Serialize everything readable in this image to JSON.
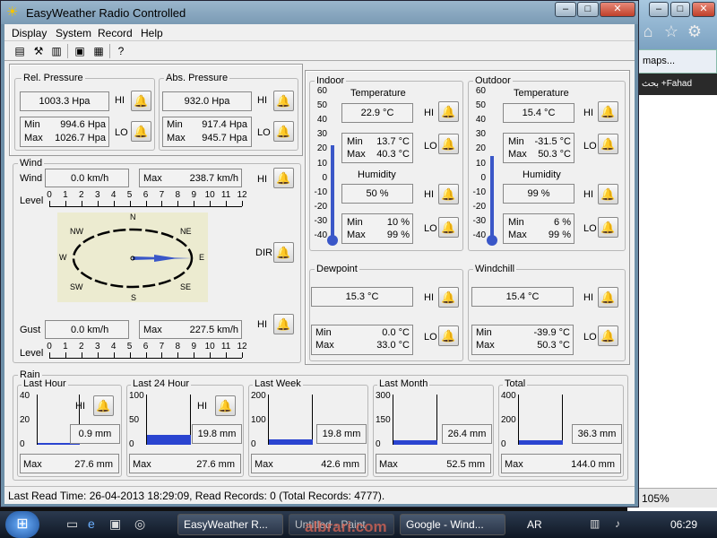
{
  "browser": {
    "tab_label": "maps...",
    "bar_text": "Fahad+ بحث",
    "zoom": "105%"
  },
  "window": {
    "title": "EasyWeather Radio Controlled",
    "min": "–",
    "max": "□",
    "close": "✕"
  },
  "menu": [
    "Display",
    "System",
    "Record",
    "Help"
  ],
  "pressure": {
    "rel_label": "Rel. Pressure",
    "rel_value": "1003.3 Hpa",
    "rel_min": "994.6 Hpa",
    "rel_max": "1026.7 Hpa",
    "abs_label": "Abs. Pressure",
    "abs_value": "932.0 Hpa",
    "abs_min": "917.4 Hpa",
    "abs_max": "945.7 Hpa",
    "min_label": "Min",
    "max_label": "Max"
  },
  "labels": {
    "hi": "HI",
    "lo": "LO",
    "dir": "DIR",
    "min": "Min",
    "max": "Max"
  },
  "wind": {
    "group": "Wind",
    "wind_label": "Wind",
    "wind_value": "0.0 km/h",
    "max_label": "Max",
    "wind_max": "238.7 km/h",
    "level_label": "Level",
    "gust_label": "Gust",
    "gust_value": "0.0 km/h",
    "gust_max": "227.5 km/h",
    "scale": [
      "0",
      "1",
      "2",
      "3",
      "4",
      "5",
      "6",
      "7",
      "8",
      "9",
      "10",
      "11",
      "12"
    ],
    "compass": {
      "N": "N",
      "NE": "NE",
      "E": "E",
      "SE": "SE",
      "S": "S",
      "SW": "SW",
      "W": "W",
      "NW": "NW"
    }
  },
  "indoor": {
    "group": "Indoor",
    "temp_label": "Temperature",
    "temp_value": "22.9 °C",
    "temp_min": "13.7 °C",
    "temp_max": "40.3 °C",
    "hum_label": "Humidity",
    "hum_value": "50 %",
    "hum_min": "10 %",
    "hum_max": "99 %",
    "thermo_temp": 22.9
  },
  "outdoor": {
    "group": "Outdoor",
    "temp_label": "Temperature",
    "temp_value": "15.4 °C",
    "temp_min": "-31.5 °C",
    "temp_max": "50.3 °C",
    "hum_label": "Humidity",
    "hum_value": "99 %",
    "hum_min": "6 %",
    "hum_max": "99 %",
    "thermo_temp": 15.4
  },
  "temp_scale": [
    "60",
    "50",
    "40",
    "30",
    "20",
    "10",
    "0",
    "-10",
    "-20",
    "-30",
    "-40"
  ],
  "dewpoint": {
    "group": "Dewpoint",
    "value": "15.3 °C",
    "min": "0.0 °C",
    "max": "33.0 °C"
  },
  "windchill": {
    "group": "Windchill",
    "value": "15.4 °C",
    "min": "-39.9 °C",
    "max": "50.3 °C"
  },
  "rain": {
    "group": "Rain",
    "panels": [
      {
        "label": "Last Hour",
        "scale": [
          "40",
          "20",
          "0"
        ],
        "value": "0.9 mm",
        "max": "27.6 mm",
        "fill": 0.02
      },
      {
        "label": "Last 24 Hour",
        "scale": [
          "100",
          "50",
          "0"
        ],
        "value": "19.8 mm",
        "max": "27.6 mm",
        "fill": 0.2
      },
      {
        "label": "Last Week",
        "scale": [
          "200",
          "100",
          "0"
        ],
        "value": "19.8 mm",
        "max": "42.6 mm",
        "fill": 0.1
      },
      {
        "label": "Last Month",
        "scale": [
          "300",
          "150",
          "0"
        ],
        "value": "26.4 mm",
        "max": "52.5 mm",
        "fill": 0.09
      },
      {
        "label": "Total",
        "scale": [
          "400",
          "200",
          "0"
        ],
        "value": "36.3 mm",
        "max": "144.0 mm",
        "fill": 0.09
      }
    ]
  },
  "status": "Last Read Time: 26-04-2013 18:29:09, Read Records: 0 (Total Records: 4777).",
  "taskbar": {
    "tasks": [
      "EasyWeather R...",
      "Untitled - Paint",
      "Google - Wind..."
    ],
    "lang": "AR",
    "clock": "06:29"
  },
  "watermark": "albrari.com"
}
